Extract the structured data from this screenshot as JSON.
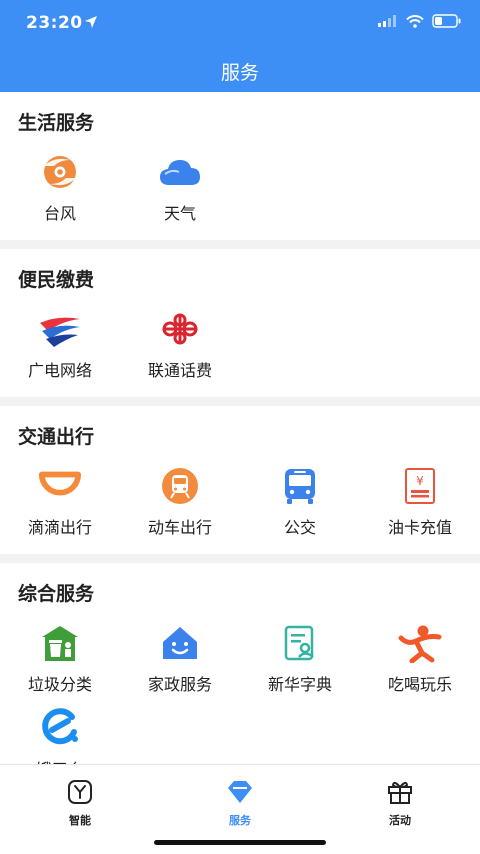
{
  "status": {
    "time": "23:20"
  },
  "header": {
    "title": "服务"
  },
  "sections": [
    {
      "title": "生活服务",
      "items": [
        {
          "label": "台风",
          "icon": "typhoon-icon"
        },
        {
          "label": "天气",
          "icon": "cloud-icon"
        }
      ]
    },
    {
      "title": "便民缴费",
      "items": [
        {
          "label": "广电网络",
          "icon": "broadcast-network-logo"
        },
        {
          "label": "联通话费",
          "icon": "china-unicom-logo"
        }
      ]
    },
    {
      "title": "交通出行",
      "items": [
        {
          "label": "滴滴出行",
          "icon": "didi-logo"
        },
        {
          "label": "动车出行",
          "icon": "train-icon"
        },
        {
          "label": "公交",
          "icon": "bus-icon"
        },
        {
          "label": "油卡充值",
          "icon": "fuel-card-icon"
        }
      ]
    },
    {
      "title": "综合服务",
      "items": [
        {
          "label": "垃圾分类",
          "icon": "trash-sorting-icon"
        },
        {
          "label": "家政服务",
          "icon": "home-service-icon"
        },
        {
          "label": "新华字典",
          "icon": "dictionary-icon"
        },
        {
          "label": "吃喝玩乐",
          "icon": "leisure-icon"
        },
        {
          "label": "饿了么",
          "icon": "eleme-logo"
        }
      ]
    }
  ],
  "tabs": [
    {
      "label": "智能",
      "icon": "smart-icon"
    },
    {
      "label": "服务",
      "icon": "diamond-icon",
      "active": true
    },
    {
      "label": "活动",
      "icon": "gift-icon"
    }
  ],
  "colors": {
    "primary": "#3d8ef5",
    "background": "#f2f2f2"
  }
}
